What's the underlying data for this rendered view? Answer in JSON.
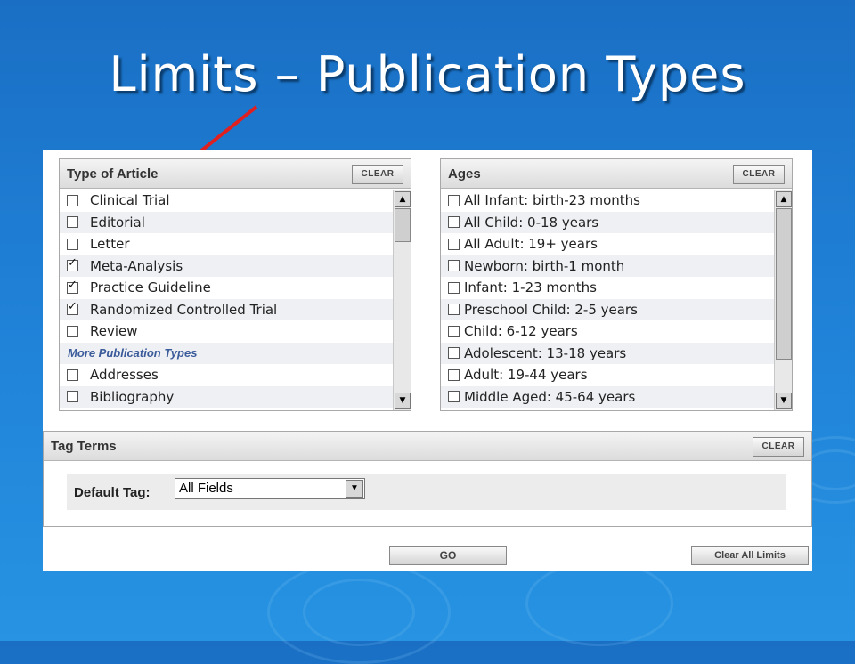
{
  "slide": {
    "title": "Limits – Publication Types"
  },
  "type_of_article": {
    "header": "Type of Article",
    "clear_label": "CLEAR",
    "items": [
      {
        "label": "Clinical Trial",
        "checked": false
      },
      {
        "label": "Editorial",
        "checked": false
      },
      {
        "label": "Letter",
        "checked": false
      },
      {
        "label": "Meta-Analysis",
        "checked": true
      },
      {
        "label": "Practice Guideline",
        "checked": true
      },
      {
        "label": "Randomized Controlled Trial",
        "checked": true
      },
      {
        "label": "Review",
        "checked": false
      }
    ],
    "more_label": "More Publication Types",
    "more_items": [
      {
        "label": "Addresses",
        "checked": false
      },
      {
        "label": "Bibliography",
        "checked": false
      }
    ]
  },
  "ages": {
    "header": "Ages",
    "clear_label": "CLEAR",
    "items": [
      {
        "label": "All Infant: birth-23 months",
        "checked": false
      },
      {
        "label": "All Child: 0-18 years",
        "checked": false
      },
      {
        "label": "All Adult: 19+ years",
        "checked": false
      },
      {
        "label": "Newborn: birth-1 month",
        "checked": false
      },
      {
        "label": "Infant: 1-23 months",
        "checked": false
      },
      {
        "label": "Preschool Child: 2-5 years",
        "checked": false
      },
      {
        "label": "Child: 6-12 years",
        "checked": false
      },
      {
        "label": "Adolescent: 13-18 years",
        "checked": false
      },
      {
        "label": "Adult: 19-44 years",
        "checked": false
      },
      {
        "label": "Middle Aged: 45-64 years",
        "checked": false
      }
    ]
  },
  "tag_terms": {
    "header": "Tag Terms",
    "clear_label": "CLEAR",
    "default_tag_label": "Default Tag:",
    "default_tag_value": "All Fields"
  },
  "actions": {
    "go_label": "GO",
    "clear_all_label": "Clear All Limits"
  },
  "colors": {
    "arrow": "#e02020",
    "title": "#ffffff",
    "more_link": "#3b5b9a"
  }
}
